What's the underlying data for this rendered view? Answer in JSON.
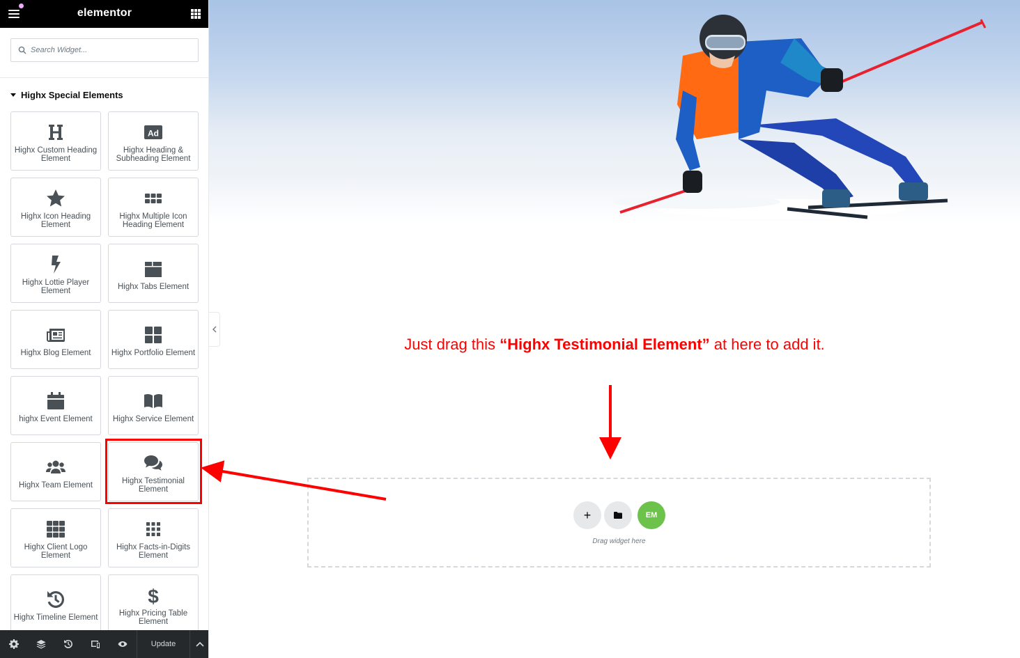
{
  "app": {
    "brand": "elementor"
  },
  "search": {
    "placeholder": "Search Widget..."
  },
  "category": {
    "title": "Highx Special Elements"
  },
  "widgets": [
    {
      "label": "Highx Custom Heading Element",
      "icon": "heading-icon"
    },
    {
      "label": "Highx Heading & Subheading Element",
      "icon": "ad-icon"
    },
    {
      "label": "Highx Icon Heading Element",
      "icon": "star-icon"
    },
    {
      "label": "Highx Multiple Icon Heading Element",
      "icon": "grid-icon"
    },
    {
      "label": "Highx Lottie Player Element",
      "icon": "bolt-icon"
    },
    {
      "label": "Highx Tabs Element",
      "icon": "tabs-icon"
    },
    {
      "label": "Highx Blog Element",
      "icon": "newspaper-icon"
    },
    {
      "label": "Highx Portfolio Element",
      "icon": "portfolio-icon"
    },
    {
      "label": "highx Event Element",
      "icon": "calendar-icon"
    },
    {
      "label": "Highx Service Element",
      "icon": "book-icon"
    },
    {
      "label": "Highx Team Element",
      "icon": "users-icon"
    },
    {
      "label": "Highx Testimonial Element",
      "icon": "comments-icon"
    },
    {
      "label": "Highx Client Logo Element",
      "icon": "logo-grid-icon"
    },
    {
      "label": "Highx Facts-in-Digits Element",
      "icon": "digits-icon"
    },
    {
      "label": "Highx Timeline Element",
      "icon": "history-icon"
    },
    {
      "label": "Highx Pricing Table Element",
      "icon": "dollar-icon"
    }
  ],
  "bottombar": {
    "update_label": "Update"
  },
  "instruction": {
    "prefix": "Just drag this ",
    "highlight": "“Highx Testimonial Element”",
    "suffix": " at here to add it."
  },
  "dropzone": {
    "text": "Drag widget here",
    "add_label": "+",
    "brand_label": "EM"
  },
  "colors": {
    "annotation": "#ff0000",
    "topbar": "#000000",
    "bottombar": "#26292c",
    "widget_icon": "#495157"
  }
}
